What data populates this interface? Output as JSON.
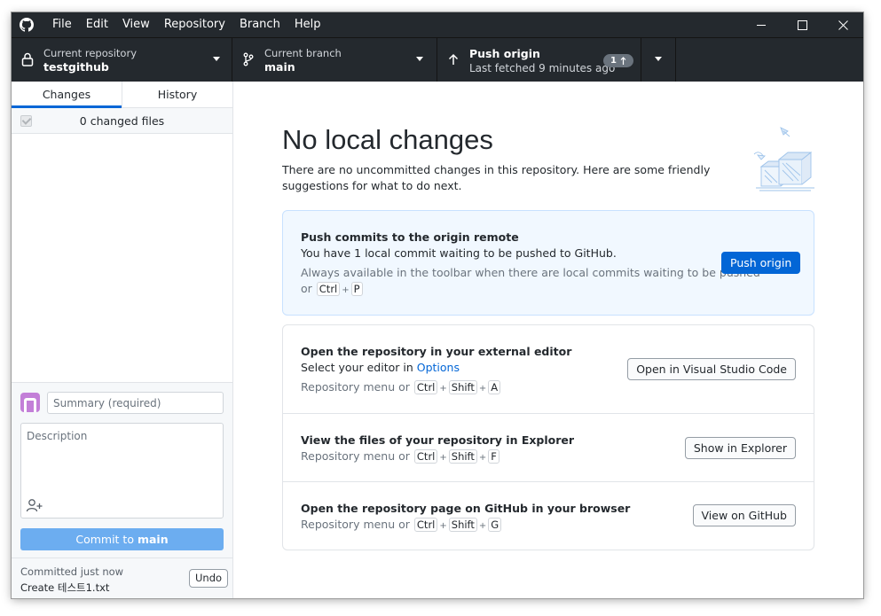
{
  "titlebar": {
    "menu": [
      "File",
      "Edit",
      "View",
      "Repository",
      "Branch",
      "Help"
    ]
  },
  "toolbar": {
    "repo_label": "Current repository",
    "repo_value": "testgithub",
    "branch_label": "Current branch",
    "branch_value": "main",
    "push_title": "Push origin",
    "push_sub": "Last fetched 9 minutes ago",
    "push_badge": "1"
  },
  "sidebar": {
    "tabs": [
      "Changes",
      "History"
    ],
    "active_tab": "Changes",
    "changed_files": "0 changed files",
    "summary_placeholder": "Summary (required)",
    "description_placeholder": "Description",
    "commit_prefix": "Commit to ",
    "commit_branch": "main",
    "last_commit_time": "Committed just now",
    "last_commit_msg": "Create 테스트1.txt",
    "undo_label": "Undo"
  },
  "main": {
    "title": "No local changes",
    "intro": "There are no uncommitted changes in this repository. Here are some friendly suggestions for what to do next.",
    "push_card": {
      "title": "Push commits to the origin remote",
      "sub": "You have 1 local commit waiting to be pushed to GitHub.",
      "hint": "Always available in the toolbar when there are local commits waiting to be pushed",
      "hint_or": "or",
      "keys": [
        "Ctrl",
        "P"
      ],
      "button": "Push origin"
    },
    "editor_card": {
      "title": "Open the repository in your external editor",
      "sub_prefix": "Select your editor in ",
      "sub_link": "Options",
      "hint": "Repository menu or",
      "keys": [
        "Ctrl",
        "Shift",
        "A"
      ],
      "button": "Open in Visual Studio Code"
    },
    "explorer_card": {
      "title": "View the files of your repository in Explorer",
      "hint": "Repository menu or",
      "keys": [
        "Ctrl",
        "Shift",
        "F"
      ],
      "button": "Show in Explorer"
    },
    "github_card": {
      "title": "Open the repository page on GitHub in your browser",
      "hint": "Repository menu or",
      "keys": [
        "Ctrl",
        "Shift",
        "G"
      ],
      "button": "View on GitHub"
    }
  },
  "colors": {
    "chrome": "#24292e",
    "accent": "#0366d6",
    "commit_button": "#6cadf0",
    "push_card_bg": "#f1f8ff"
  },
  "icons": [
    "github-logo-icon",
    "minimize-icon",
    "maximize-icon",
    "close-icon",
    "lock-icon",
    "branch-icon",
    "arrow-up-icon",
    "caret-down-icon",
    "add-coauthor-icon",
    "checkbox-icon"
  ]
}
